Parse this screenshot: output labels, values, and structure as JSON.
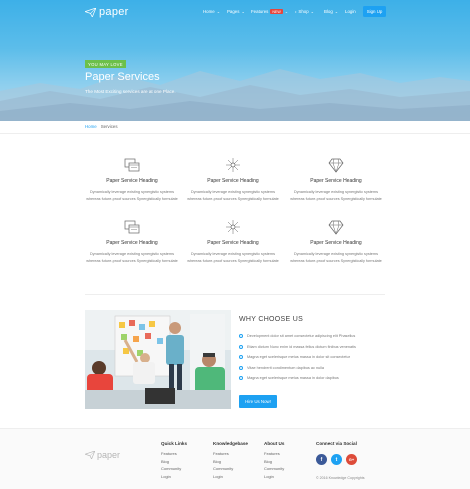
{
  "brand": {
    "name": "paper"
  },
  "nav": {
    "items": [
      {
        "label": "Home",
        "chevron": true
      },
      {
        "label": "Pages",
        "chevron": true
      },
      {
        "label": "Features",
        "badge": "NEW",
        "chevron": true
      },
      {
        "label": "Shop",
        "chevron": true
      },
      {
        "label": "Blog",
        "chevron": true
      },
      {
        "label": "Login"
      }
    ],
    "signup_label": "Sign Up"
  },
  "hero": {
    "tag": "YOU MAY LOVE",
    "title": "Paper Services",
    "subtitle": "The Most Exciting services are at one Place."
  },
  "breadcrumb": {
    "home": "Home",
    "current": "Services"
  },
  "services": [
    {
      "icon": "browser-windows-icon",
      "heading": "Paper Service Heading",
      "line1": "Dynamically leverage existing synergistic systems",
      "line2": "whereas future-proof sources Synergistically formulate"
    },
    {
      "icon": "network-nodes-icon",
      "heading": "Paper Service Heading",
      "line1": "Dynamically leverage existing synergistic systems",
      "line2": "whereas future-proof sources Synergistically formulate"
    },
    {
      "icon": "diamond-icon",
      "heading": "Paper Service Heading",
      "line1": "Dynamically leverage existing synergistic systems",
      "line2": "whereas future-proof sources Synergistically formulate"
    },
    {
      "icon": "browser-windows-icon",
      "heading": "Paper Service Heading",
      "line1": "Dynamically leverage existing synergistic systems",
      "line2": "whereas future-proof sources Synergistically formulate"
    },
    {
      "icon": "network-nodes-icon",
      "heading": "Paper Service Heading",
      "line1": "Dynamically leverage existing synergistic systems",
      "line2": "whereas future-proof sources Synergistically formulate"
    },
    {
      "icon": "diamond-icon",
      "heading": "Paper Service Heading",
      "line1": "Dynamically leverage existing synergistic systems",
      "line2": "whereas future-proof sources Synergistically formulate"
    }
  ],
  "why": {
    "title": "WHY CHOOSE US",
    "items": [
      "Development dolor sit amet consectetur adipiscing elit Phasellus",
      "Etiam dictum Nunc enim id massa fellus dictum finibus venenatis",
      "Magna eget scelerisque metus massa in dolor sit consectetur",
      "Vitae hendrerit condimentum dapibus ac nulla",
      "Magna eget scelerisque metus massa in dolor dapibus"
    ],
    "button": "Hire Us Now!"
  },
  "footer": {
    "brand": "paper",
    "columns": [
      {
        "title": "Quick Links",
        "links": [
          "Features",
          "Blog",
          "Community",
          "Login"
        ]
      },
      {
        "title": "Knowledgebase",
        "links": [
          "Features",
          "Blog",
          "Community",
          "Login"
        ]
      },
      {
        "title": "About Us",
        "links": [
          "Features",
          "Blog",
          "Community",
          "Login"
        ]
      }
    ],
    "social_title": "Connect via Social",
    "social": [
      {
        "icon": "facebook-icon",
        "glyph": "f",
        "color": "#3b5998"
      },
      {
        "icon": "twitter-icon",
        "glyph": "t",
        "color": "#1da1f2"
      },
      {
        "icon": "google-plus-icon",
        "glyph": "G+",
        "color": "#dd4b39"
      }
    ],
    "copyright": "© 2016 Knowledge Copyrights"
  },
  "colors": {
    "accent": "#1da1f2",
    "tag": "#6cc04a",
    "badge": "#e8453c"
  }
}
